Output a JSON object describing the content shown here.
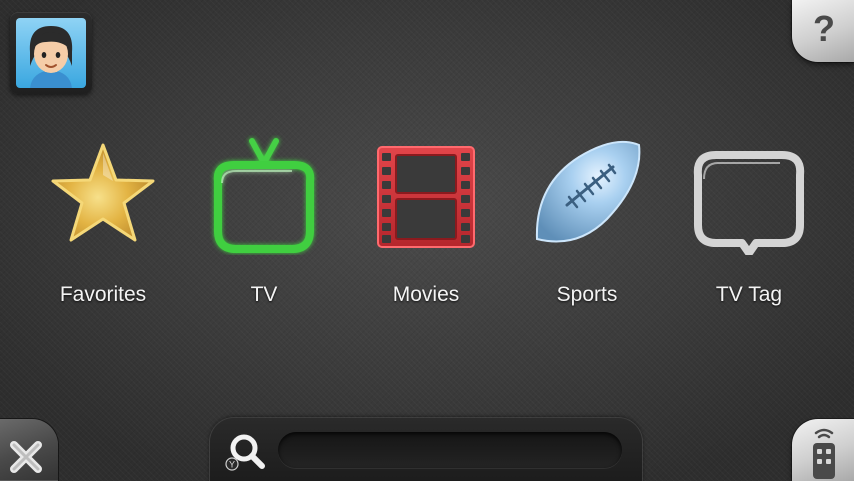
{
  "avatar": {
    "name": "mii-avatar"
  },
  "categories": [
    {
      "label": "Favorites",
      "icon": "star-icon",
      "color": "#e8b93c"
    },
    {
      "label": "TV",
      "icon": "tv-icon",
      "color": "#3fcf3f"
    },
    {
      "label": "Movies",
      "icon": "film-strip-icon",
      "color": "#d9343a"
    },
    {
      "label": "Sports",
      "icon": "football-icon",
      "color": "#8fc1e6"
    },
    {
      "label": "TV Tag",
      "icon": "speech-bubble-icon",
      "color": "#cfcfcf"
    }
  ],
  "buttons": {
    "help": {
      "glyph": "?"
    },
    "close": {
      "glyph": "✕"
    },
    "search_hint": {
      "glyph": "Y"
    }
  },
  "search": {
    "value": "",
    "placeholder": ""
  },
  "colors": {
    "background": "#3c3c3c",
    "label": "#f4f4f4"
  }
}
